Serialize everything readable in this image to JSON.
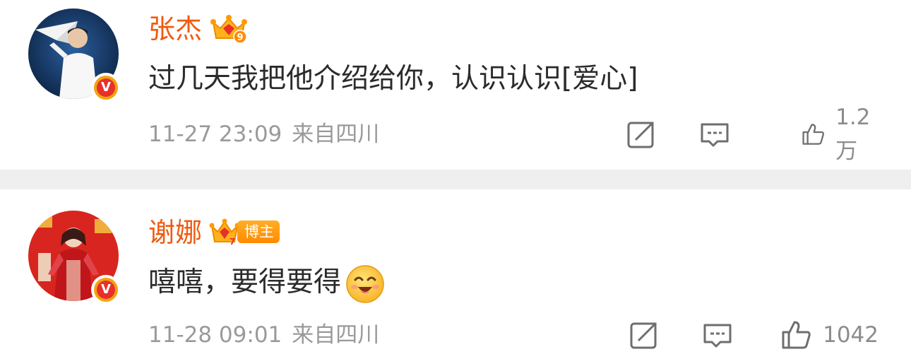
{
  "comments": [
    {
      "username": "张杰",
      "level": "9",
      "blogger_tag": "",
      "text": "过几天我把他介绍给你，认识认识[爱心]",
      "emoji": "",
      "time": "11-27 23:09",
      "location": "来自四川",
      "likes": "1.2万"
    },
    {
      "username": "谢娜",
      "level": "7",
      "blogger_tag": "博主",
      "text": "嘻嘻，要得要得",
      "emoji": "grinning-face-emoji",
      "time": "11-28 09:01",
      "location": "来自四川",
      "likes": "1042"
    }
  ],
  "icons": {
    "repost": "repost-icon",
    "comment": "comment-icon",
    "like": "thumbs-up-icon",
    "verified": "verified-v-icon",
    "level": "crown-level-icon"
  },
  "colors": {
    "username": "#f05a10",
    "text": "#2b2b2b",
    "meta": "#9a9a9a",
    "separator": "#efefef",
    "verified_red": "#e8302b",
    "badge_gold": "#f3a30f"
  }
}
